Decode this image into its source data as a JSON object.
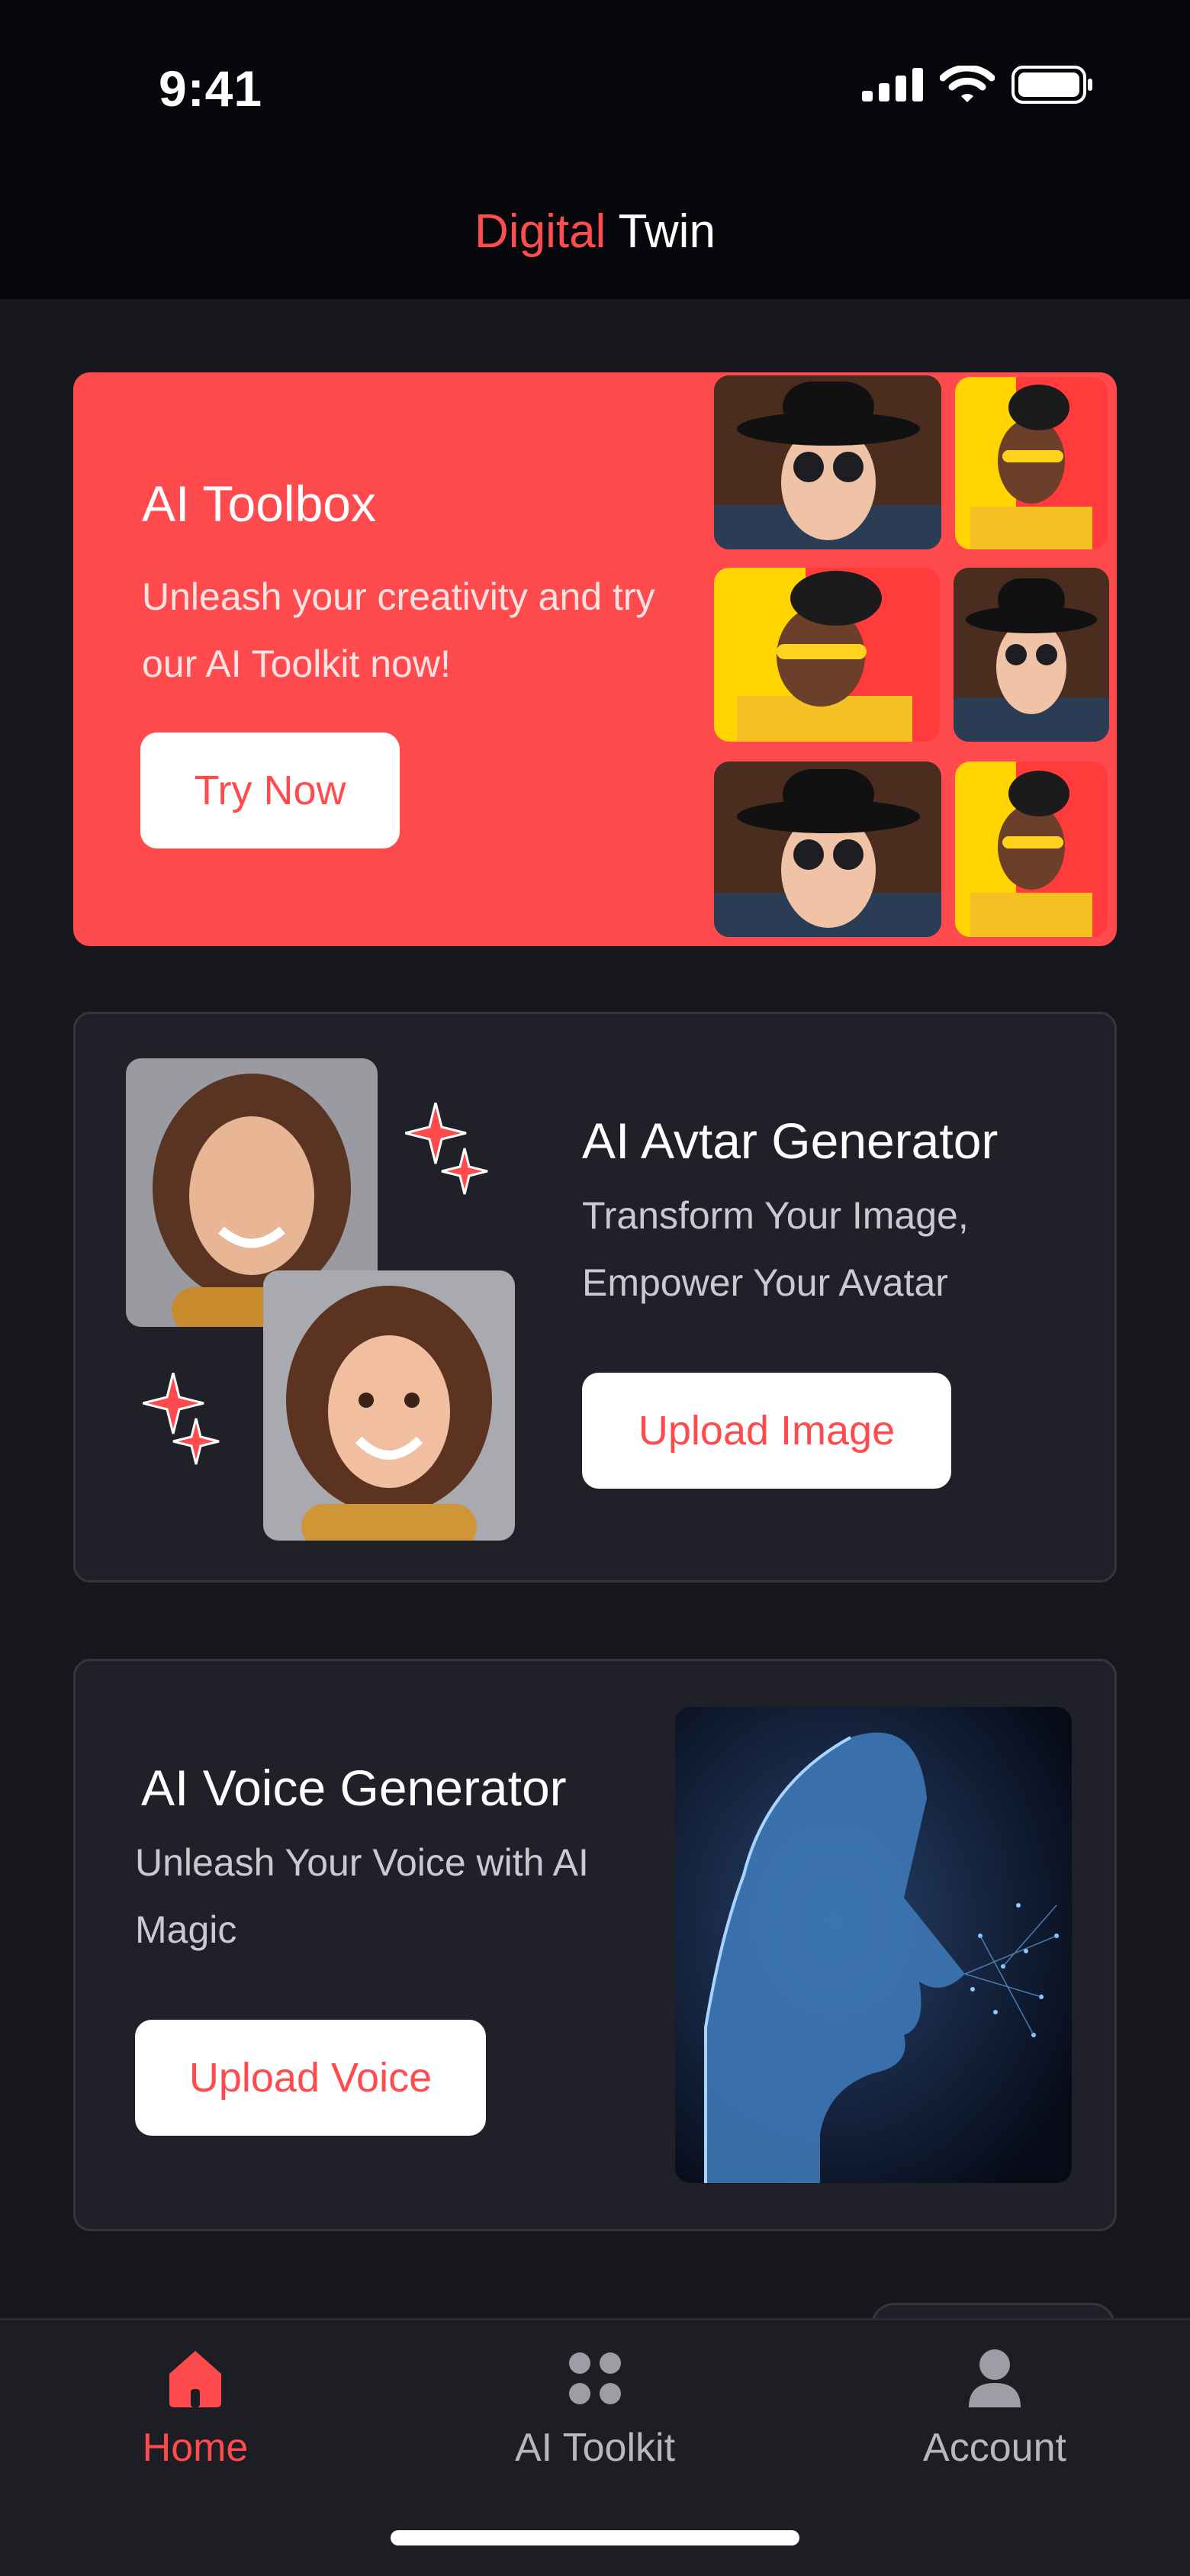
{
  "status": {
    "time": "9:41"
  },
  "header": {
    "title_accent": "Digital",
    "title_rest": " Twin"
  },
  "toolbox": {
    "title": "AI Toolbox",
    "subtitle": "Unleash your creativity and try our AI Toolkit now!",
    "button": "Try Now"
  },
  "avatar": {
    "title": "AI Avtar Generator",
    "subtitle": "Transform Your Image, Empower Your Avatar",
    "button": "Upload Image"
  },
  "voice": {
    "title": "AI Voice Generator",
    "subtitle": "Unleash Your Voice with AI Magic",
    "button": "Upload Voice"
  },
  "tabs": [
    {
      "label": "Home",
      "icon": "home-icon",
      "active": true
    },
    {
      "label": "AI Toolkit",
      "icon": "grid-dots-icon",
      "active": false
    },
    {
      "label": "Account",
      "icon": "user-icon",
      "active": false
    }
  ],
  "colors": {
    "accent": "#ff4b4d",
    "background": "#17181d",
    "card": "#202128"
  }
}
